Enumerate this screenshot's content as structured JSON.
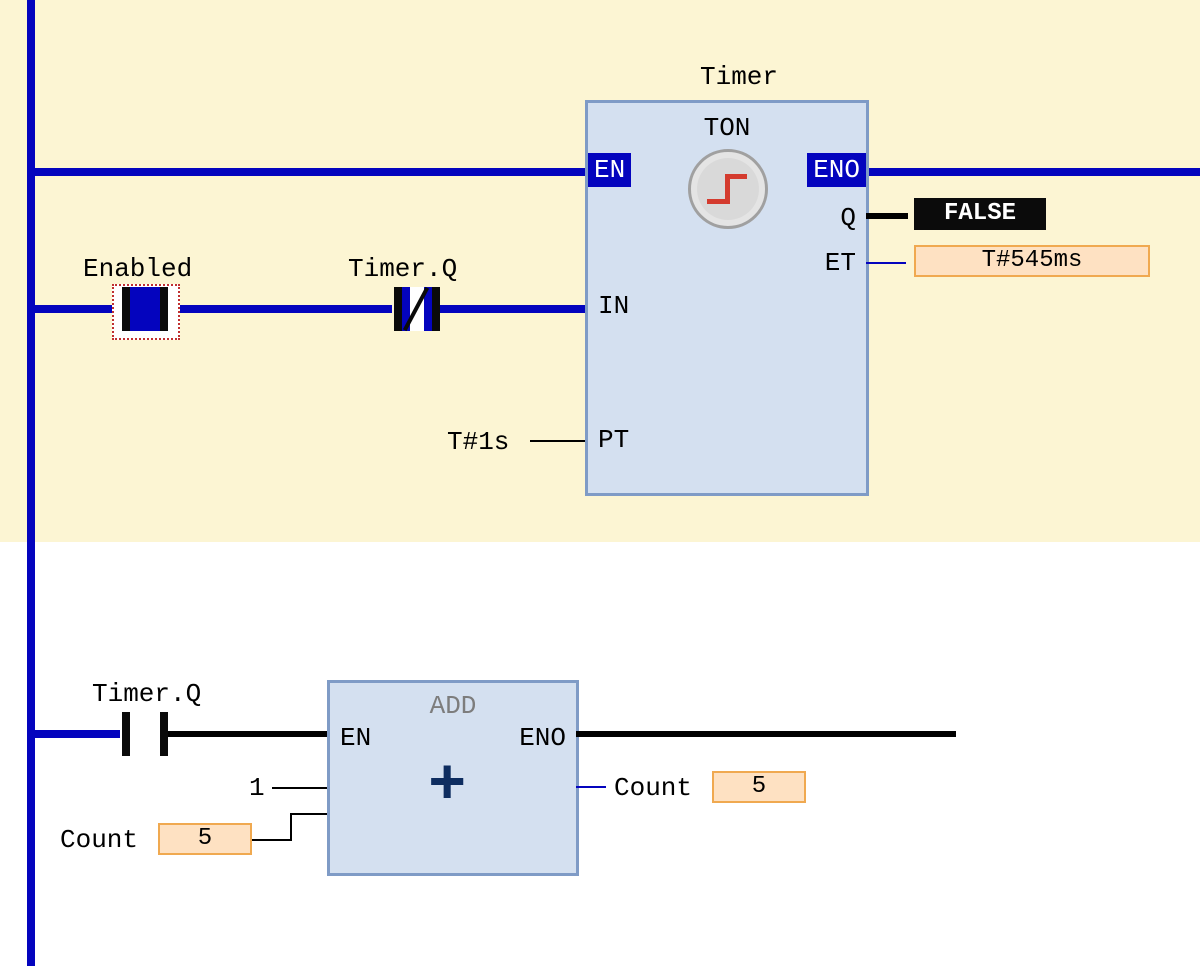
{
  "rung1": {
    "instance_label": "Timer",
    "block_type": "TON",
    "contacts": {
      "enabled": {
        "label": "Enabled",
        "state": "closed",
        "selected": true
      },
      "timer_q": {
        "label": "Timer.Q",
        "state": "nc_powered"
      }
    },
    "pins": {
      "EN": "EN",
      "ENO": "ENO",
      "IN": "IN",
      "PT": "PT",
      "Q": "Q",
      "ET": "ET"
    },
    "pt_literal": "T#1s",
    "q_value": "FALSE",
    "et_value": "T#545ms"
  },
  "rung2": {
    "block_type": "ADD",
    "contact": {
      "label": "Timer.Q",
      "state": "open"
    },
    "pins": {
      "EN": "EN",
      "ENO": "ENO"
    },
    "in_literal": "1",
    "in_var": {
      "label": "Count",
      "value": "5"
    },
    "out_var": {
      "label": "Count",
      "value": "5"
    }
  }
}
